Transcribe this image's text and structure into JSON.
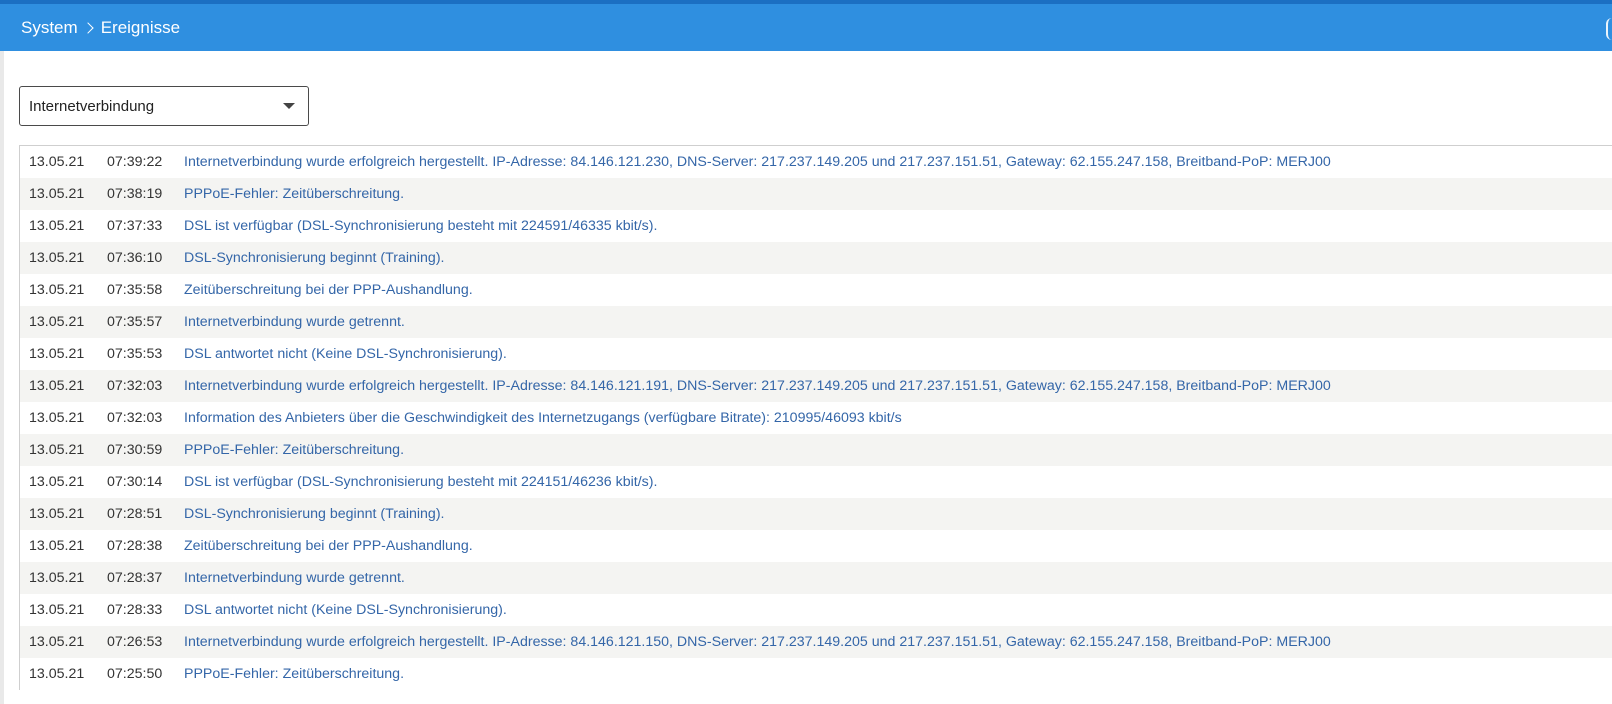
{
  "breadcrumb": {
    "parent": "System",
    "current": "Ereignisse"
  },
  "filter": {
    "selected": "Internetverbindung"
  },
  "colors": {
    "header": "#2f8fe0",
    "message": "#3466a8"
  },
  "events": [
    {
      "date": "13.05.21",
      "time": "07:39:22",
      "message": "Internetverbindung wurde erfolgreich hergestellt. IP-Adresse: 84.146.121.230, DNS-Server: 217.237.149.205 und 217.237.151.51, Gateway: 62.155.247.158, Breitband-PoP: MERJ00"
    },
    {
      "date": "13.05.21",
      "time": "07:38:19",
      "message": "PPPoE-Fehler: Zeitüberschreitung."
    },
    {
      "date": "13.05.21",
      "time": "07:37:33",
      "message": "DSL ist verfügbar (DSL-Synchronisierung besteht mit 224591/46335 kbit/s)."
    },
    {
      "date": "13.05.21",
      "time": "07:36:10",
      "message": "DSL-Synchronisierung beginnt (Training)."
    },
    {
      "date": "13.05.21",
      "time": "07:35:58",
      "message": "Zeitüberschreitung bei der PPP-Aushandlung."
    },
    {
      "date": "13.05.21",
      "time": "07:35:57",
      "message": "Internetverbindung wurde getrennt."
    },
    {
      "date": "13.05.21",
      "time": "07:35:53",
      "message": "DSL antwortet nicht (Keine DSL-Synchronisierung)."
    },
    {
      "date": "13.05.21",
      "time": "07:32:03",
      "message": "Internetverbindung wurde erfolgreich hergestellt. IP-Adresse: 84.146.121.191, DNS-Server: 217.237.149.205 und 217.237.151.51, Gateway: 62.155.247.158, Breitband-PoP: MERJ00"
    },
    {
      "date": "13.05.21",
      "time": "07:32:03",
      "message": "Information des Anbieters über die Geschwindigkeit des Internetzugangs (verfügbare Bitrate): 210995/46093 kbit/s"
    },
    {
      "date": "13.05.21",
      "time": "07:30:59",
      "message": "PPPoE-Fehler: Zeitüberschreitung."
    },
    {
      "date": "13.05.21",
      "time": "07:30:14",
      "message": "DSL ist verfügbar (DSL-Synchronisierung besteht mit 224151/46236 kbit/s)."
    },
    {
      "date": "13.05.21",
      "time": "07:28:51",
      "message": "DSL-Synchronisierung beginnt (Training)."
    },
    {
      "date": "13.05.21",
      "time": "07:28:38",
      "message": "Zeitüberschreitung bei der PPP-Aushandlung."
    },
    {
      "date": "13.05.21",
      "time": "07:28:37",
      "message": "Internetverbindung wurde getrennt."
    },
    {
      "date": "13.05.21",
      "time": "07:28:33",
      "message": "DSL antwortet nicht (Keine DSL-Synchronisierung)."
    },
    {
      "date": "13.05.21",
      "time": "07:26:53",
      "message": "Internetverbindung wurde erfolgreich hergestellt. IP-Adresse: 84.146.121.150, DNS-Server: 217.237.149.205 und 217.237.151.51, Gateway: 62.155.247.158, Breitband-PoP: MERJ00"
    },
    {
      "date": "13.05.21",
      "time": "07:25:50",
      "message": "PPPoE-Fehler: Zeitüberschreitung."
    }
  ]
}
